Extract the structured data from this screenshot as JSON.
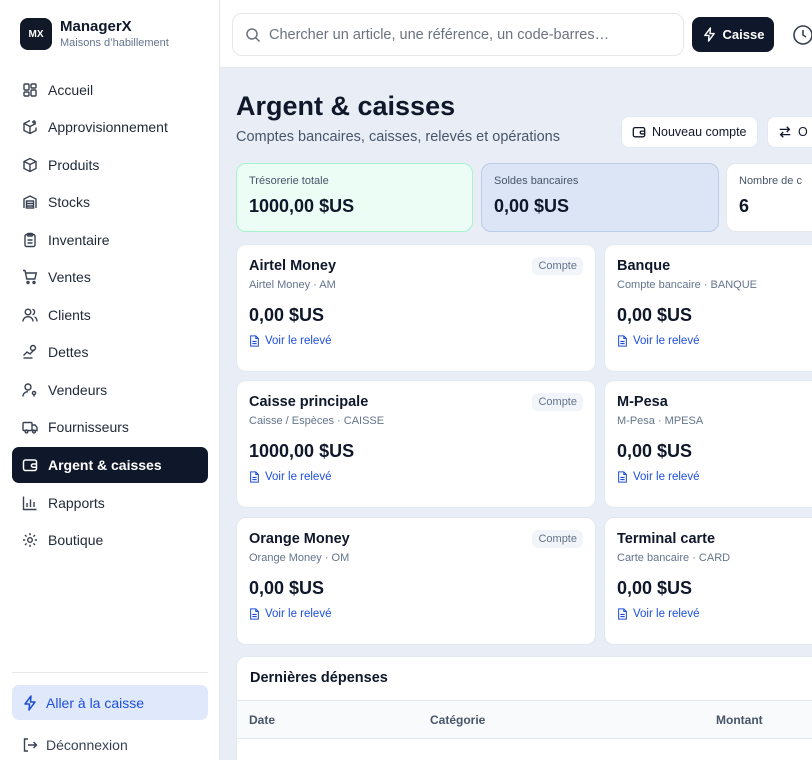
{
  "brand": {
    "logo": "MX",
    "name": "ManagerX",
    "subtitle": "Maisons d’habillement"
  },
  "nav": [
    {
      "label": "Accueil",
      "icon": "dashboard-icon"
    },
    {
      "label": "Approvisionnement",
      "icon": "package-plus-icon"
    },
    {
      "label": "Produits",
      "icon": "box-icon"
    },
    {
      "label": "Stocks",
      "icon": "warehouse-icon"
    },
    {
      "label": "Inventaire",
      "icon": "clipboard-icon"
    },
    {
      "label": "Ventes",
      "icon": "cart-icon"
    },
    {
      "label": "Clients",
      "icon": "users-icon"
    },
    {
      "label": "Dettes",
      "icon": "hand-coins-icon"
    },
    {
      "label": "Vendeurs",
      "icon": "user-key-icon"
    },
    {
      "label": "Fournisseurs",
      "icon": "truck-icon"
    },
    {
      "label": "Argent & caisses",
      "icon": "wallet-icon",
      "active": true
    },
    {
      "label": "Rapports",
      "icon": "bar-chart-icon"
    },
    {
      "label": "Boutique",
      "icon": "gear-icon"
    }
  ],
  "sidebar_footer": {
    "go_pos": "Aller à la caisse",
    "logout": "Déconnexion"
  },
  "topbar": {
    "search_placeholder": "Chercher un article, une référence, un code-barres…",
    "pos_button": "Caisse"
  },
  "page": {
    "title": "Argent & caisses",
    "subtitle": "Comptes bancaires, caisses, relevés et opérations",
    "new_account": "Nouveau compte",
    "transfer": "O"
  },
  "stats": [
    {
      "label": "Trésorerie totale",
      "value": "1000,00 $US"
    },
    {
      "label": "Soldes bancaires",
      "value": "0,00 $US"
    },
    {
      "label": "Nombre de c",
      "value": "6"
    }
  ],
  "accounts": [
    {
      "name": "Airtel Money",
      "meta": "Airtel Money · AM",
      "amount": "0,00 $US",
      "link": "Voir le relevé",
      "badge": "Compte"
    },
    {
      "name": "Banque",
      "meta": "Compte bancaire · BANQUE",
      "amount": "0,00 $US",
      "link": "Voir le relevé"
    },
    {
      "name": "Caisse principale",
      "meta": "Caisse / Espèces · CAISSE",
      "amount": "1000,00 $US",
      "link": "Voir le relevé",
      "badge": "Compte"
    },
    {
      "name": "M-Pesa",
      "meta": "M-Pesa · MPESA",
      "amount": "0,00 $US",
      "link": "Voir le relevé"
    },
    {
      "name": "Orange Money",
      "meta": "Orange Money · OM",
      "amount": "0,00 $US",
      "link": "Voir le relevé",
      "badge": "Compte"
    },
    {
      "name": "Terminal carte",
      "meta": "Carte bancaire · CARD",
      "amount": "0,00 $US",
      "link": "Voir le relevé"
    }
  ],
  "expenses": {
    "title": "Dernières dépenses",
    "columns": [
      "Date",
      "Catégorie",
      "Montant"
    ]
  },
  "colors": {
    "primary": "#0f172a",
    "link": "#1d4ed8",
    "background": "#e9eef6"
  }
}
